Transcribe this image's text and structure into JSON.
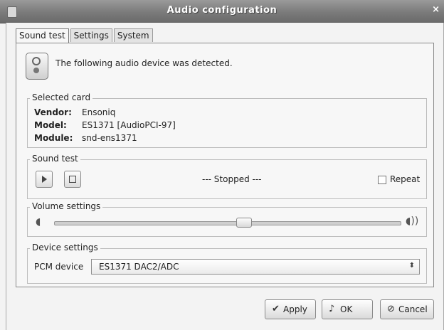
{
  "window": {
    "title": "Audio configuration"
  },
  "tabs": [
    {
      "label": "Sound test",
      "active": true
    },
    {
      "label": "Settings"
    },
    {
      "label": "System"
    }
  ],
  "detect": {
    "icon": "speaker-icon",
    "text": "The following audio device was detected."
  },
  "selected_card": {
    "label": "Selected card",
    "vendor_key": "Vendor:",
    "vendor_val": "Ensoniq",
    "model_key": "Model:",
    "model_val": "ES1371 [AudioPCI-97]",
    "module_key": "Module:",
    "module_val": "snd-ens1371"
  },
  "sound_test": {
    "label": "Sound test",
    "status": "--- Stopped ---",
    "repeat_label": "Repeat",
    "repeat_checked": false
  },
  "volume": {
    "label": "Volume settings",
    "level": 0.55
  },
  "device": {
    "label": "Device settings",
    "pcm_label": "PCM device",
    "pcm_value": "ES1371 DAC2/ADC"
  },
  "buttons": {
    "apply": "Apply",
    "ok": "OK",
    "cancel": "Cancel"
  }
}
